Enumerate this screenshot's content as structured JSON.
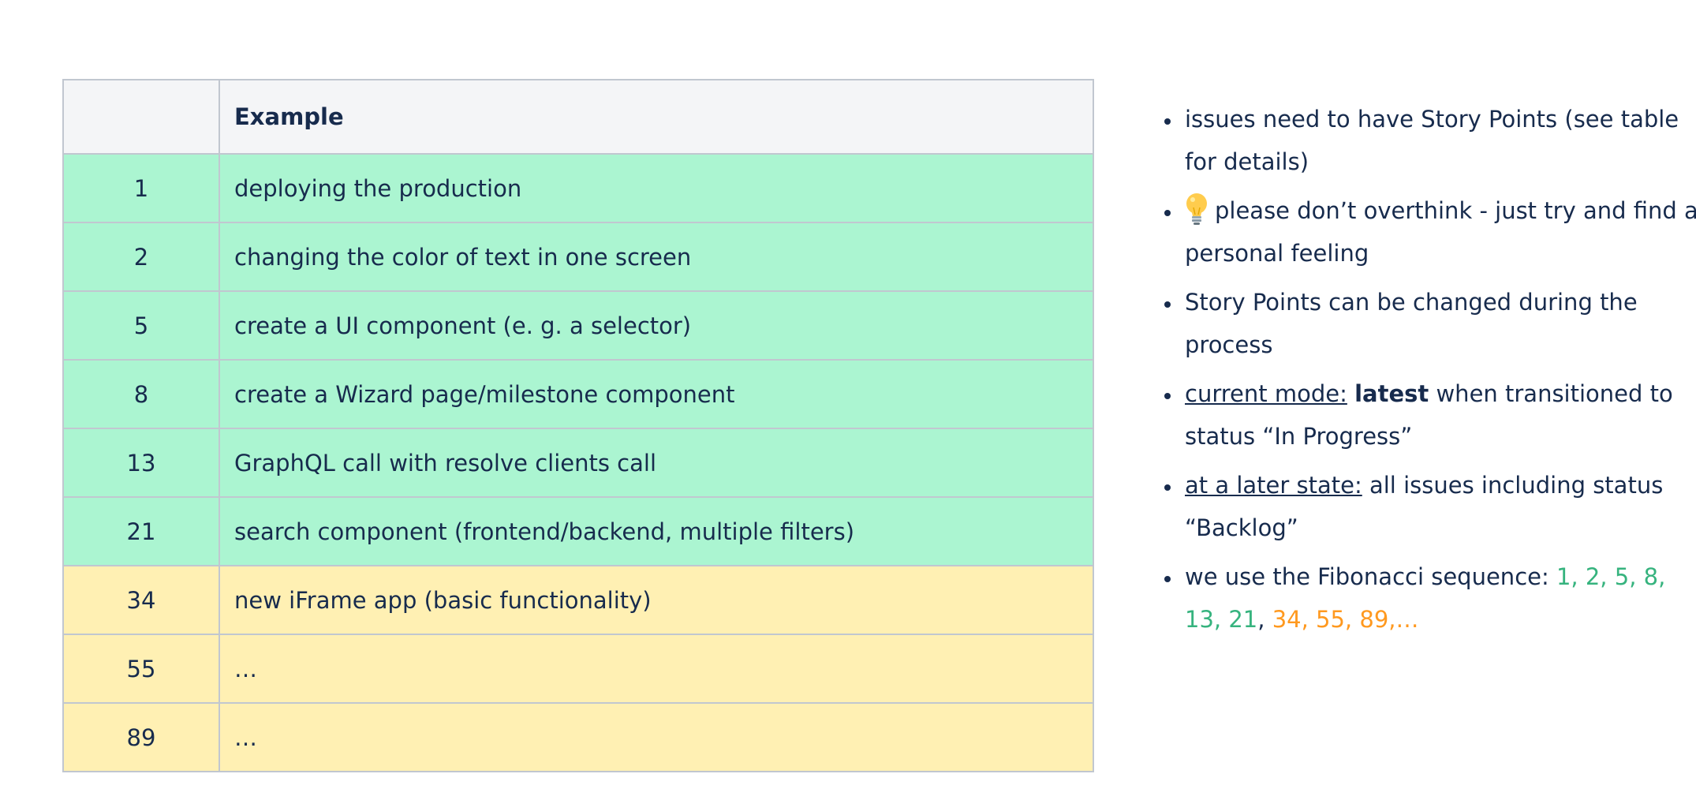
{
  "table": {
    "header": {
      "points": "",
      "example": "Example"
    },
    "rows": [
      {
        "points": "1",
        "example": "deploying the production",
        "tone": "green"
      },
      {
        "points": "2",
        "example": "changing the color of text in one screen",
        "tone": "green"
      },
      {
        "points": "5",
        "example": "create a UI component (e. g. a selector)",
        "tone": "green"
      },
      {
        "points": "8",
        "example": "create a Wizard page/milestone component",
        "tone": "green"
      },
      {
        "points": "13",
        "example": "GraphQL call with resolve clients call",
        "tone": "green"
      },
      {
        "points": "21",
        "example": "search component (frontend/backend, multiple filters)",
        "tone": "green"
      },
      {
        "points": "34",
        "example": "new iFrame app (basic functionality)",
        "tone": "yellow"
      },
      {
        "points": "55",
        "example": "…",
        "tone": "yellow"
      },
      {
        "points": "89",
        "example": "…",
        "tone": "yellow"
      }
    ]
  },
  "notes": {
    "item1": "issues need to have Story Points (see table for details)",
    "item2": "please don’t overthink - just try and find a personal feeling",
    "item2_icon": "lightbulb-icon",
    "item3": "Story Points can be changed during the process",
    "item4": {
      "label": "current mode:",
      "bold": "latest",
      "rest": " when transitioned to status “In Progress”"
    },
    "item5": {
      "label": "at a later state:",
      "rest": " all issues including status “Backlog”"
    },
    "item6": {
      "prefix": "we use the Fibonacci sequence: ",
      "green": "1, 2, 5, 8, 13, 21",
      "sep": ", ",
      "orange": "34, 55, 89,…"
    }
  },
  "colors": {
    "green_row": "#abf5d1",
    "yellow_row": "#fff0b3",
    "header_bg": "#f4f5f7",
    "green_text": "#36b37e",
    "orange_text": "#ff991f",
    "text": "#172b4d"
  }
}
